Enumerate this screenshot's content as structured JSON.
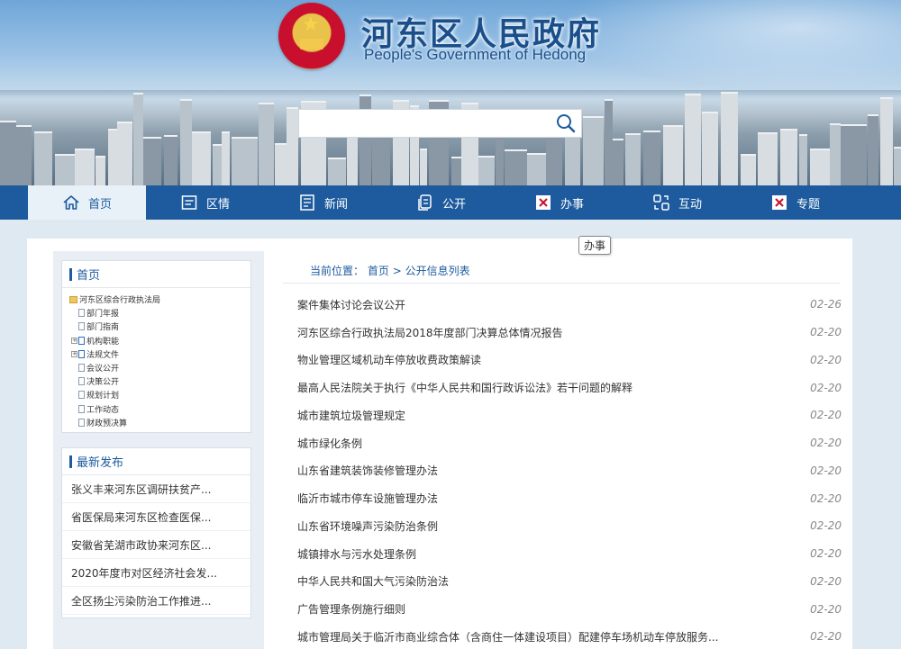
{
  "header": {
    "title": "河东区人民政府",
    "subtitle": "People's Government of Hedong",
    "search": {
      "placeholder": "",
      "value": "",
      "button_icon": "search-icon"
    }
  },
  "nav": {
    "items": [
      {
        "label": "首页",
        "icon": "home-icon",
        "active": true
      },
      {
        "label": "区情",
        "icon": "document-icon"
      },
      {
        "label": "新闻",
        "icon": "news-icon"
      },
      {
        "label": "公开",
        "icon": "copy-icon"
      },
      {
        "label": "办事",
        "icon": "close-box-icon"
      },
      {
        "label": "互动",
        "icon": "interact-icon"
      },
      {
        "label": "专题",
        "icon": "close-box-icon"
      }
    ],
    "tooltip": "办事"
  },
  "sidebar": {
    "home_title": "首页",
    "tree": [
      {
        "label": "河东区综合行政执法局",
        "level": 0,
        "type": "folder"
      },
      {
        "label": "部门年报",
        "level": 1,
        "type": "doc"
      },
      {
        "label": "部门指南",
        "level": 1,
        "type": "doc"
      },
      {
        "label": "机构职能",
        "level": 1,
        "type": "doc-expand"
      },
      {
        "label": "法规文件",
        "level": 1,
        "type": "doc-expand"
      },
      {
        "label": "会议公开",
        "level": 1,
        "type": "doc"
      },
      {
        "label": "决策公开",
        "level": 1,
        "type": "doc"
      },
      {
        "label": "规划计划",
        "level": 1,
        "type": "doc"
      },
      {
        "label": "工作动态",
        "level": 1,
        "type": "doc"
      },
      {
        "label": "财政预决算",
        "level": 1,
        "type": "doc"
      }
    ],
    "latest_title": "最新发布",
    "latest": [
      "张义丰来河东区调研扶贫产...",
      "省医保局来河东区检查医保...",
      "安徽省芜湖市政协来河东区...",
      "2020年度市对区经济社会发...",
      "全区扬尘污染防治工作推进..."
    ]
  },
  "breadcrumb": {
    "prefix": "当前位置：",
    "home": "首页",
    "sep": ">",
    "current": "公开信息列表"
  },
  "list": [
    {
      "title": "案件集体讨论会议公开",
      "date": "02-26"
    },
    {
      "title": "河东区综合行政执法局2018年度部门决算总体情况报告",
      "date": "02-20"
    },
    {
      "title": "物业管理区域机动车停放收费政策解读",
      "date": "02-20"
    },
    {
      "title": "最高人民法院关于执行《中华人民共和国行政诉讼法》若干问题的解释",
      "date": "02-20"
    },
    {
      "title": "城市建筑垃圾管理规定",
      "date": "02-20"
    },
    {
      "title": "城市绿化条例",
      "date": "02-20"
    },
    {
      "title": "山东省建筑装饰装修管理办法",
      "date": "02-20"
    },
    {
      "title": "临沂市城市停车设施管理办法",
      "date": "02-20"
    },
    {
      "title": "山东省环境噪声污染防治条例",
      "date": "02-20"
    },
    {
      "title": "城镇排水与污水处理条例",
      "date": "02-20"
    },
    {
      "title": "中华人民共和国大气污染防治法",
      "date": "02-20"
    },
    {
      "title": "广告管理条例施行细则",
      "date": "02-20"
    },
    {
      "title": "城市管理局关于临沂市商业综合体（含商住一体建设项目）配建停车场机动车停放服务...",
      "date": "02-20"
    }
  ],
  "colors": {
    "primary": "#1d5b9e",
    "background": "#dfe9f2"
  }
}
